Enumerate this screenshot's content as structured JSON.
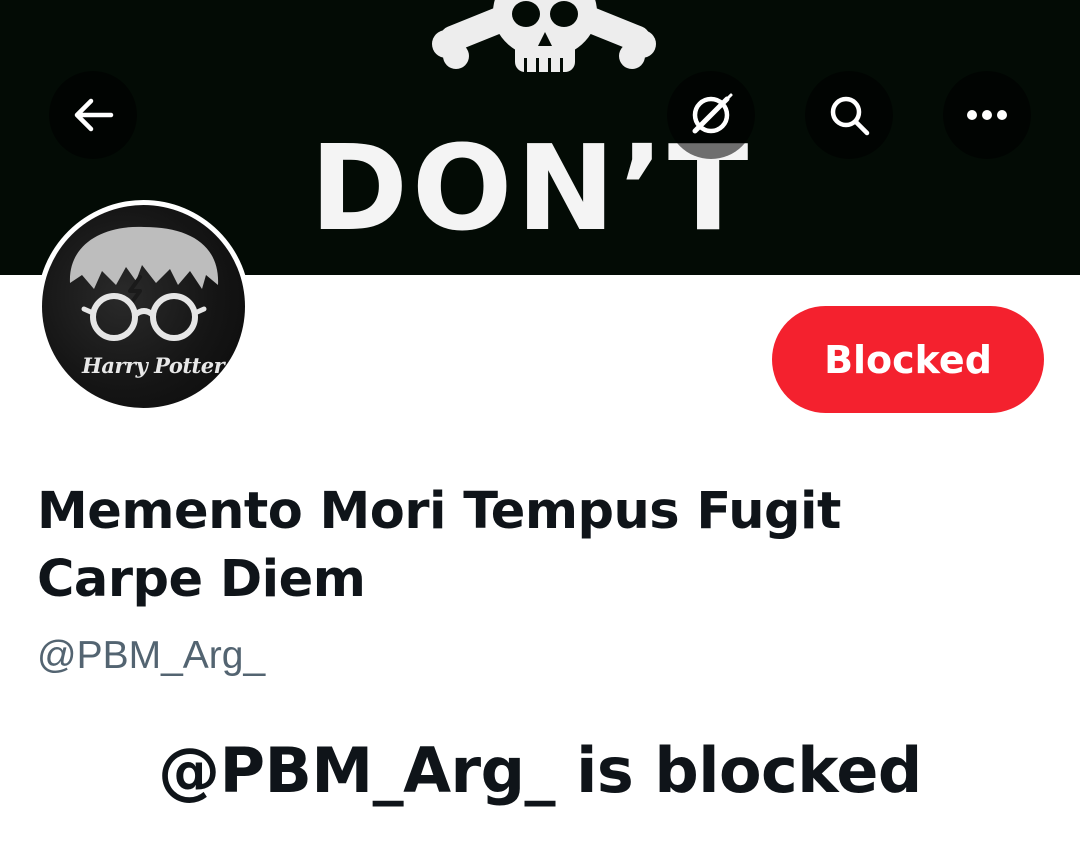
{
  "banner": {
    "text": "DON’T",
    "image": "skull-and-crossbones-banner"
  },
  "nav": {
    "back_icon": "back-arrow-icon",
    "grok_icon": "grok-icon",
    "search_icon": "search-icon",
    "more_icon": "more-icon"
  },
  "profile": {
    "avatar_caption": "Harry Potter",
    "display_name": "Memento Mori Tempus Fugit Carpe Diem",
    "handle": "@PBM_Arg_",
    "blocked_button_label": "Blocked",
    "blocked_notice": "@PBM_Arg_ is blocked"
  },
  "colors": {
    "blocked_red": "#f4212e",
    "text_primary": "#0f1419",
    "text_secondary": "#536471",
    "banner_bg": "#030b05"
  }
}
